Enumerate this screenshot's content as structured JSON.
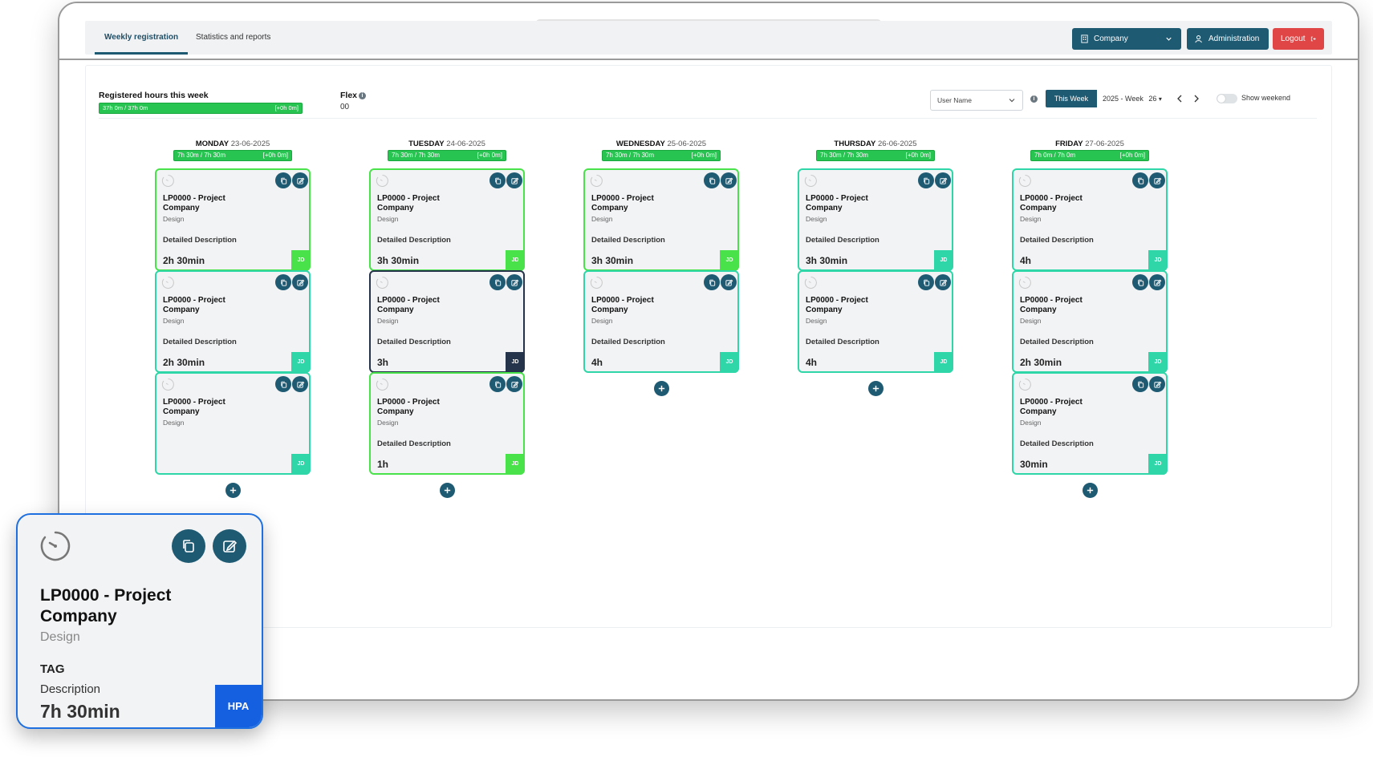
{
  "app": {
    "tabs": [
      {
        "label": "Weekly registration",
        "active": true
      },
      {
        "label": "Statistics and reports",
        "active": false
      }
    ],
    "company_select": "Company",
    "admin_button": "Administration",
    "logout_button": "Logout",
    "colors": {
      "primary": "#1f5a73",
      "logout": "#e04646",
      "progress": "#27c451",
      "teal": "#2fd6a7",
      "green": "#49e24a",
      "dark": "#25344a",
      "hpa": "#1560e0"
    }
  },
  "summary": {
    "registered_title": "Registered hours this week",
    "registered_value": "37h 0m / 37h 0m",
    "registered_delta": "[+0h 0m]",
    "flex_label": "Flex",
    "flex_value": "00"
  },
  "controls": {
    "user_select": "User Name",
    "this_week": "This Week",
    "week_prefix": "2025 - Week",
    "week_number": "26",
    "show_weekend": "Show weekend"
  },
  "days": [
    {
      "name": "MONDAY",
      "date": "23-06-2025",
      "total": "7h 30m / 7h 30m",
      "delta": "[+0h 0m]",
      "entries": [
        {
          "title1": "LP0000 - Project",
          "title2": "Company",
          "category": "Design",
          "description": "Detailed Description",
          "hours": "2h 30min",
          "initials": "JD",
          "style": "green"
        },
        {
          "title1": "LP0000 - Project",
          "title2": "Company",
          "category": "Design",
          "description": "Detailed Description",
          "hours": "2h 30min",
          "initials": "JD",
          "style": "teal"
        },
        {
          "title1": "LP0000 - Project",
          "title2": "Company",
          "category": "Design",
          "description": "",
          "hours": "",
          "initials": "JD",
          "style": "teal"
        }
      ]
    },
    {
      "name": "TUESDAY",
      "date": "24-06-2025",
      "total": "7h 30m / 7h 30m",
      "delta": "[+0h 0m]",
      "entries": [
        {
          "title1": "LP0000 - Project",
          "title2": "Company",
          "category": "Design",
          "description": "Detailed Description",
          "hours": "3h 30min",
          "initials": "JD",
          "style": "green"
        },
        {
          "title1": "LP0000 - Project",
          "title2": "Company",
          "category": "Design",
          "description": "Detailed Description",
          "hours": "3h",
          "initials": "JD",
          "style": "dark"
        },
        {
          "title1": "LP0000 - Project",
          "title2": "Company",
          "category": "Design",
          "description": "Detailed Description",
          "hours": "1h",
          "initials": "JD",
          "style": "green"
        }
      ]
    },
    {
      "name": "WEDNESDAY",
      "date": "25-06-2025",
      "total": "7h 30m / 7h 30m",
      "delta": "[+0h 0m]",
      "entries": [
        {
          "title1": "LP0000 - Project",
          "title2": "Company",
          "category": "Design",
          "description": "Detailed Description",
          "hours": "3h 30min",
          "initials": "JD",
          "style": "green"
        },
        {
          "title1": "LP0000 - Project",
          "title2": "Company",
          "category": "Design",
          "description": "Detailed Description",
          "hours": "4h",
          "initials": "JD",
          "style": "teal"
        }
      ]
    },
    {
      "name": "THURSDAY",
      "date": "26-06-2025",
      "total": "7h 30m / 7h 30m",
      "delta": "[+0h 0m]",
      "entries": [
        {
          "title1": "LP0000 - Project",
          "title2": "Company",
          "category": "Design",
          "description": "Detailed Description",
          "hours": "3h 30min",
          "initials": "JD",
          "style": "teal"
        },
        {
          "title1": "LP0000 - Project",
          "title2": "Company",
          "category": "Design",
          "description": "Detailed Description",
          "hours": "4h",
          "initials": "JD",
          "style": "teal"
        }
      ]
    },
    {
      "name": "FRIDAY",
      "date": "27-06-2025",
      "total": "7h 0m / 7h 0m",
      "delta": "[+0h 0m]",
      "entries": [
        {
          "title1": "LP0000 - Project",
          "title2": "Company",
          "category": "Design",
          "description": "Detailed Description",
          "hours": "4h",
          "initials": "JD",
          "style": "teal"
        },
        {
          "title1": "LP0000 - Project",
          "title2": "Company",
          "category": "Design",
          "description": "Detailed Description",
          "hours": "2h 30min",
          "initials": "JD",
          "style": "teal"
        },
        {
          "title1": "LP0000 - Project",
          "title2": "Company",
          "category": "Design",
          "description": "Detailed Description",
          "hours": "30min",
          "initials": "JD",
          "style": "teal"
        }
      ]
    }
  ],
  "featured_card": {
    "title1": "LP0000 - Project",
    "title2": "Company",
    "category": "Design",
    "tag": "TAG",
    "description": "Description",
    "hours": "7h 30min",
    "badge": "HPA"
  }
}
